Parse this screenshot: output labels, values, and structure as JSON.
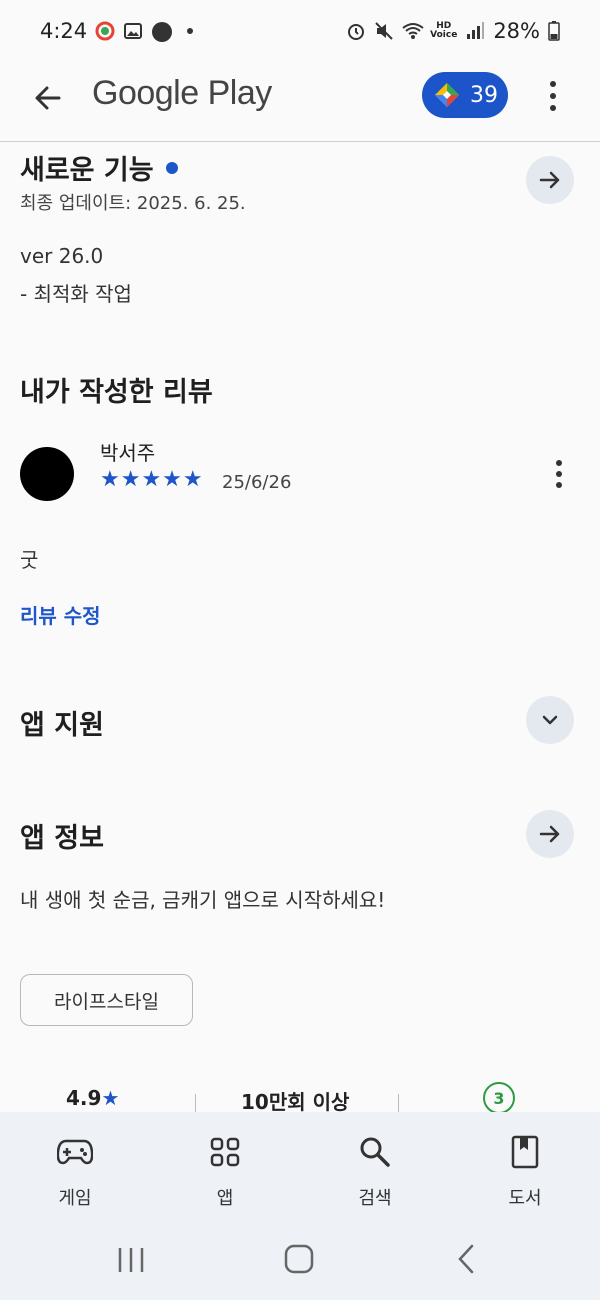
{
  "status_bar": {
    "time": "4:24",
    "battery": "28%",
    "hd_voice_line1": "HD",
    "hd_voice_line2": "Voice"
  },
  "app_bar": {
    "brand": "Google Play",
    "points": "39"
  },
  "whats_new": {
    "title": "새로운 기능",
    "updated": "최종 업데이트: 2025. 6. 25.",
    "version": "ver 26.0",
    "notes": "- 최적화 작업"
  },
  "my_review": {
    "heading": "내가 작성한 리뷰",
    "author": "박서주",
    "stars": "★★★★★",
    "rating": 5,
    "date": "25/6/26",
    "text": "굿",
    "edit_link": "리뷰 수정"
  },
  "app_support": {
    "title": "앱 지원"
  },
  "app_info": {
    "title": "앱 정보",
    "description": "내 생애 첫 순금, 금캐기 앱으로 시작하세요!",
    "category_chip": "라이프스타일"
  },
  "stats": {
    "rating": "4.9",
    "rating_star": "★",
    "downloads": "10만회 이상",
    "age_rating": "3"
  },
  "bottom_nav": {
    "items": [
      {
        "label": "게임",
        "icon": "gamepad-icon"
      },
      {
        "label": "앱",
        "icon": "apps-grid-icon"
      },
      {
        "label": "검색",
        "icon": "search-icon"
      },
      {
        "label": "도서",
        "icon": "book-icon"
      }
    ]
  },
  "colors": {
    "accent": "#1e56c9",
    "points_bg": "#1b55c9",
    "nav_bg": "#eef1f6",
    "age_badge": "#2e9b42"
  }
}
